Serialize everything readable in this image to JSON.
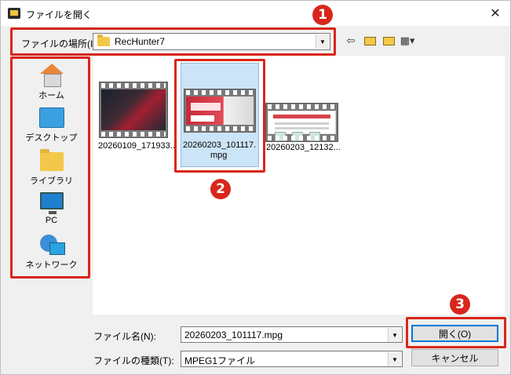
{
  "window": {
    "title": "ファイルを開く",
    "close_glyph": "✕"
  },
  "lookin": {
    "label": "ファイルの場所(I):",
    "value": "RecHunter7"
  },
  "toolbar": {
    "back_glyph": "⇦",
    "view_glyph": "▦▾"
  },
  "places": [
    {
      "label": "ホーム",
      "icon": "home-icon"
    },
    {
      "label": "デスクトップ",
      "icon": "desktop-icon"
    },
    {
      "label": "ライブラリ",
      "icon": "library-folder-icon"
    },
    {
      "label": "PC",
      "icon": "pc-icon"
    },
    {
      "label": "ネットワーク",
      "icon": "network-icon"
    }
  ],
  "files": [
    {
      "name_line1": "20260109_171933...",
      "name_line2": ""
    },
    {
      "name_line1": "20260203_101117.",
      "name_line2": "mpg"
    },
    {
      "name_line1": "20260203_12132...",
      "name_line2": ""
    }
  ],
  "filename": {
    "label": "ファイル名(N):",
    "value": "20260203_101117.mpg"
  },
  "filetype": {
    "label": "ファイルの種類(T):",
    "value": "MPEG1ファイル"
  },
  "buttons": {
    "open": "開く(O)",
    "cancel": "キャンセル"
  },
  "annotations": {
    "badge1": "1",
    "badge2": "2",
    "badge3": "3",
    "color": "#d9261c"
  },
  "colors": {
    "selection": "#cce4f7",
    "accent": "#0078d7"
  }
}
